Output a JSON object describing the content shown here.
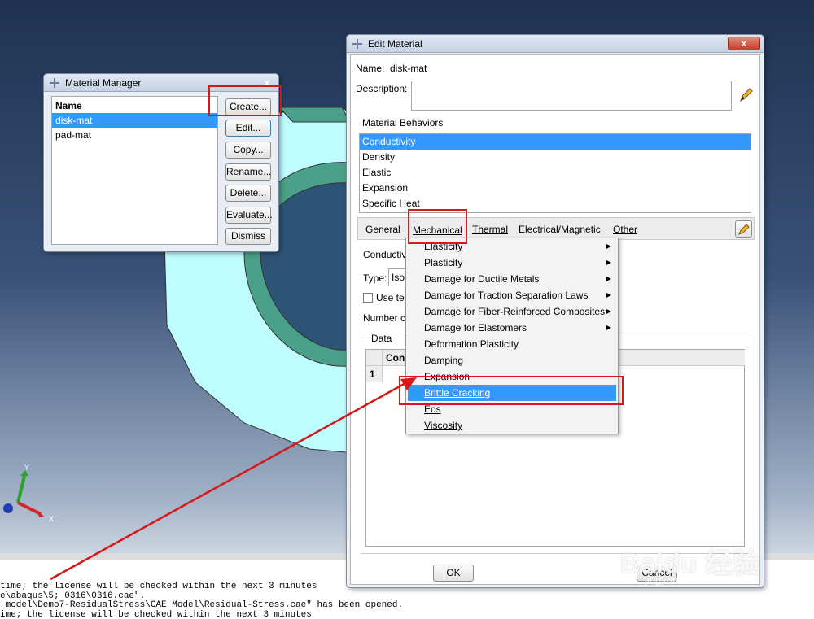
{
  "material_manager": {
    "title": "Material Manager",
    "close_label": "x",
    "list_header": "Name",
    "items": [
      "disk-mat",
      "pad-mat"
    ],
    "buttons": {
      "create": "Create...",
      "edit": "Edit...",
      "copy": "Copy...",
      "rename": "Rename...",
      "delete": "Delete...",
      "evaluate": "Evaluate...",
      "dismiss": "Dismiss"
    }
  },
  "edit_material": {
    "title": "Edit Material",
    "close_label": "x",
    "name_label": "Name:",
    "name_value": "disk-mat",
    "description_label": "Description:",
    "behaviors_label": "Material Behaviors",
    "behaviors": [
      "Conductivity",
      "Density",
      "Elastic",
      "Expansion",
      "Specific Heat"
    ],
    "tabs": [
      "General",
      "Mechanical",
      "Thermal",
      "Electrical/Magnetic",
      "Other"
    ],
    "section_label": "Conductivi",
    "type_label": "Type:",
    "type_value": "Iso",
    "use_temp_label": "Use ter",
    "number_label": "Number c",
    "data_label": "Data",
    "column_header": "Cond",
    "row_number": "1",
    "ok_button": "OK",
    "cancel_button": "Cancel"
  },
  "mechanical_menu": {
    "items": [
      {
        "label": "Elasticity",
        "submenu": true
      },
      {
        "label": "Plasticity",
        "submenu": true
      },
      {
        "label": "Damage for Ductile Metals",
        "submenu": true
      },
      {
        "label": "Damage for Traction Separation Laws",
        "submenu": true
      },
      {
        "label": "Damage for Fiber-Reinforced Composites",
        "submenu": true
      },
      {
        "label": "Damage for Elastomers",
        "submenu": true
      },
      {
        "label": "Deformation Plasticity",
        "submenu": false
      },
      {
        "label": "Damping",
        "submenu": false
      },
      {
        "label": "Expansion",
        "submenu": false
      },
      {
        "label": "Brittle Cracking",
        "submenu": false,
        "highlighted": true
      },
      {
        "label": "Eos",
        "submenu": false
      },
      {
        "label": "Viscosity",
        "submenu": false
      }
    ]
  },
  "triad": {
    "x": "X",
    "y": "Y"
  },
  "console": {
    "lines": [
      "time; the license will be checked within the next 3 minutes",
      "e\\abaqus\\5; 0316\\0316.cae\".",
      " model\\Demo7-ResidualStress\\CAE Model\\Residual-Stress.cae\" has been opened.",
      "ime; the license will be checked within the next 3 minutes"
    ]
  },
  "watermark": "Baidu 经验",
  "watermark_url": "jingyan.baidu.com",
  "colors": {
    "highlight": "#3399ff",
    "annotation": "#d51818",
    "part": "#bffcff"
  }
}
